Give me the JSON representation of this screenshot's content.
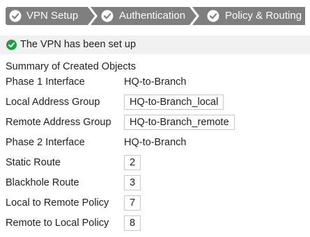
{
  "wizard": {
    "steps": [
      {
        "label": "VPN Setup",
        "icon": "check-circle-icon"
      },
      {
        "label": "Authentication",
        "icon": "check-circle-icon"
      },
      {
        "label": "Policy & Routing",
        "icon": "check-circle-icon"
      }
    ]
  },
  "banner": {
    "text": "The VPN has been set up",
    "icon": "check-circle-icon",
    "icon_color": "#1aa33c"
  },
  "summary": {
    "title": "Summary of Created Objects",
    "rows": [
      {
        "label": "Phase 1 Interface",
        "value": "HQ-to-Branch"
      },
      {
        "label": "Local Address Group",
        "value": "HQ-to-Branch_local"
      },
      {
        "label": "Remote Address Group",
        "value": "HQ-to-Branch_remote"
      },
      {
        "label": "Phase 2 Interface",
        "value": "HQ-to-Branch"
      },
      {
        "label": "Static Route",
        "value": "2"
      },
      {
        "label": "Blackhole Route",
        "value": "3"
      },
      {
        "label": "Local to Remote Policy",
        "value": "7"
      },
      {
        "label": "Remote to Local Policy",
        "value": "8"
      }
    ]
  },
  "colors": {
    "step_background": "#7f7f7f",
    "step_text": "#ffffff",
    "banner_background": "#f1f1f1",
    "box_border": "#c8c8c8"
  }
}
